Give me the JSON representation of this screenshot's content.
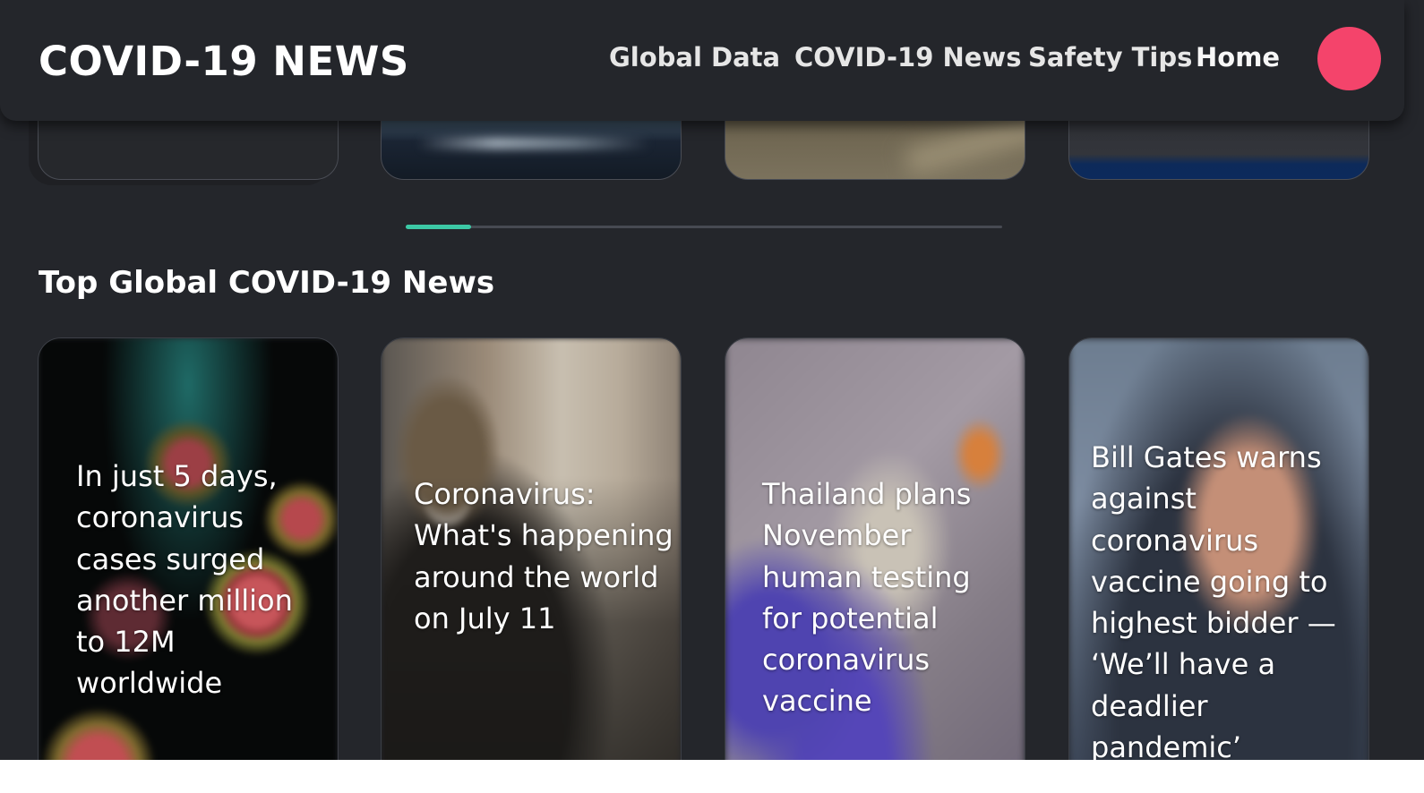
{
  "header": {
    "brand": "COVID-19 NEWS",
    "nav": [
      {
        "label": "Global Data"
      },
      {
        "label": "COVID-19 News"
      },
      {
        "label": "Safety Tips"
      },
      {
        "label": "Home"
      }
    ],
    "avatar_color": "#f4446b"
  },
  "carousel": {
    "progress_fraction": 0.11,
    "accent": "#3cc8a5"
  },
  "section": {
    "title": "Top Global COVID-19 News",
    "cards": [
      {
        "headline": "In just 5 days, coronavirus cases surged another million to 12M worldwide"
      },
      {
        "headline": "Coronavirus: What's happening around the world on July 11"
      },
      {
        "headline": "Thailand plans November human testing for potential coronavirus vaccine"
      },
      {
        "headline": "Bill Gates warns against coronavirus vaccine going to highest bidder — ‘We’ll have a deadlier pandemic’"
      }
    ]
  },
  "colors": {
    "background": "#24262b",
    "text": "#ffffff"
  }
}
